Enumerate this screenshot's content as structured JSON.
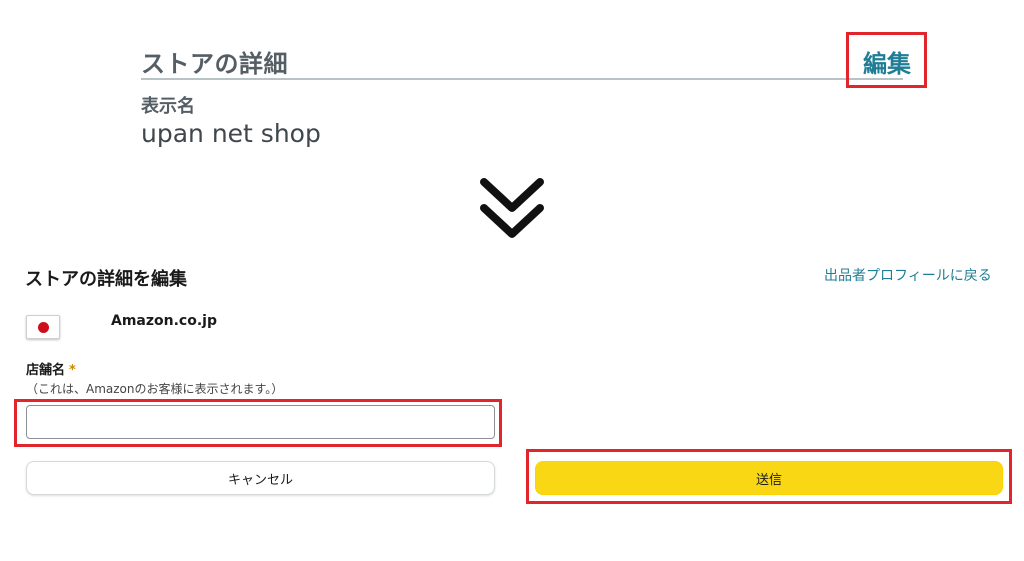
{
  "store_details": {
    "title": "ストアの詳細",
    "edit_label": "編集",
    "display_name_label": "表示名",
    "display_name_value": "upan net shop"
  },
  "arrow_icon": "double-chevron-down-icon",
  "edit_form": {
    "title": "ストアの詳細を編集",
    "back_link": "出品者プロフィールに戻る",
    "marketplace": {
      "flag_icon": "japan-flag-icon",
      "name": "Amazon.co.jp"
    },
    "store_name": {
      "label": "店舗名",
      "required_mark": "*",
      "help": "（これは、Amazonのお客様に表示されます。）",
      "value": "",
      "placeholder": ""
    },
    "cancel_label": "キャンセル",
    "submit_label": "送信"
  },
  "colors": {
    "highlight": "#e0262b",
    "link": "#1f7e95",
    "submit": "#fad715"
  }
}
